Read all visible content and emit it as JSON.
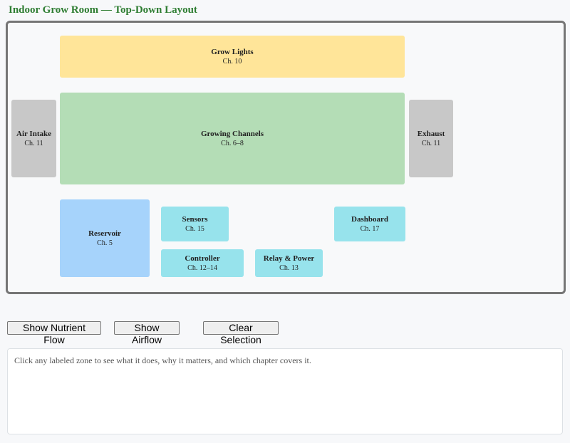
{
  "title": "Indoor Grow Room — Top-Down Layout",
  "zones": {
    "grow_lights": {
      "name": "Grow Lights",
      "chapter": "Ch. 10",
      "color": "#ffe599"
    },
    "growing_channels": {
      "name": "Growing Channels",
      "chapter": "Ch. 6–8",
      "color": "#b4ddb6"
    },
    "air_intake": {
      "name": "Air Intake",
      "chapter": "Ch. 11",
      "color": "#c8c8c8"
    },
    "exhaust": {
      "name": "Exhaust",
      "chapter": "Ch. 11",
      "color": "#c8c8c8"
    },
    "reservoir": {
      "name": "Reservoir",
      "chapter": "Ch. 5",
      "color": "#a6d3fb"
    },
    "sensors": {
      "name": "Sensors",
      "chapter": "Ch. 15",
      "color": "#97e3ec"
    },
    "controller": {
      "name": "Controller",
      "chapter": "Ch. 12–14",
      "color": "#97e3ec"
    },
    "relay_power": {
      "name": "Relay & Power",
      "chapter": "Ch. 13",
      "color": "#97e3ec"
    },
    "dashboard": {
      "name": "Dashboard",
      "chapter": "Ch. 17",
      "color": "#97e3ec"
    }
  },
  "buttons": {
    "nutrient_flow": "Show Nutrient Flow",
    "airflow": "Show Airflow",
    "clear": "Clear Selection"
  },
  "info_text": "Click any labeled zone to see what it does, why it matters, and which chapter covers it."
}
